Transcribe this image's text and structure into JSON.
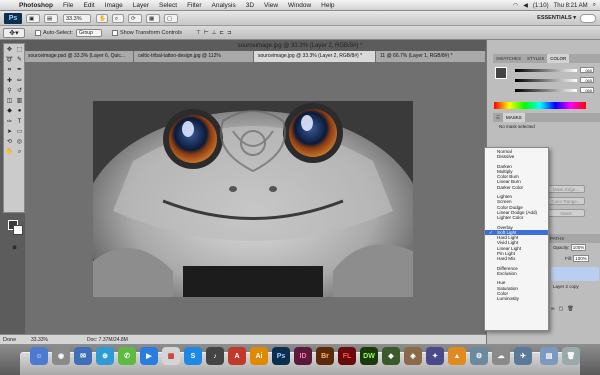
{
  "menubar": {
    "app_name": "Photoshop",
    "items": [
      "File",
      "Edit",
      "Image",
      "Layer",
      "Select",
      "Filter",
      "Analysis",
      "3D",
      "View",
      "Window",
      "Help"
    ],
    "battery": "(1:10)",
    "clock": "Thu 8:21 AM"
  },
  "appbar": {
    "logo": "Ps",
    "zoom": "33.3%",
    "workspace": "ESSENTIALS ▾"
  },
  "options": {
    "auto_select_label": "Auto-Select:",
    "auto_select_value": "Group",
    "transform_label": "Show Transform Controls"
  },
  "document_title": "sourceimage.jpg @ 33.3% (Layer 2, RGB/8#) *",
  "tabs": [
    "sourceimage.psd @ 33.3% (Layer 6, Quic...",
    "celtic-tribal-tattoo-design.jpg @ 112%",
    "sourceimage.jpg @ 33.3% (Layer 2, RGB/8#) *",
    "11 @ 66.7% (Layer 1, RGB/8#) *"
  ],
  "panels": {
    "color_tabs": [
      "SWATCHES",
      "STYLES",
      "COLOR"
    ],
    "color_values": [
      "065",
      "065",
      "065"
    ],
    "mask_tabs": [
      "MASKS"
    ],
    "mask_status": "No mask selected",
    "layer_tabs": [
      "LAYERS",
      "CHANNELS",
      "PATHS"
    ],
    "opacity_label": "Opacity:",
    "opacity_value": "100%",
    "fill_label": "Fill:",
    "fill_value": "100%",
    "layer_name": "Layer 2 copy",
    "buttons": [
      "Mask Edge...",
      "Color Range...",
      "Invert"
    ]
  },
  "blend_modes": [
    [
      "Normal",
      "Dissolve"
    ],
    [
      "Darken",
      "Multiply",
      "Color Burn",
      "Linear Burn",
      "Darker Color"
    ],
    [
      "Lighten",
      "Screen",
      "Color Dodge",
      "Linear Dodge (Add)",
      "Lighter Color"
    ],
    [
      "Overlay",
      "Soft Light",
      "Hard Light",
      "Vivid Light",
      "Linear Light",
      "Pin Light",
      "Hard Mix"
    ],
    [
      "Difference",
      "Exclusion"
    ],
    [
      "Hue",
      "Saturation",
      "Color",
      "Luminosity"
    ]
  ],
  "blend_selected": "Soft Light",
  "status": {
    "done": "Done",
    "zoom": "33.33%",
    "doc": "Doc: 7.37M/24.8M"
  },
  "dock": [
    "Ai",
    "Ps",
    "ID",
    "Br",
    "FL",
    "DW"
  ]
}
